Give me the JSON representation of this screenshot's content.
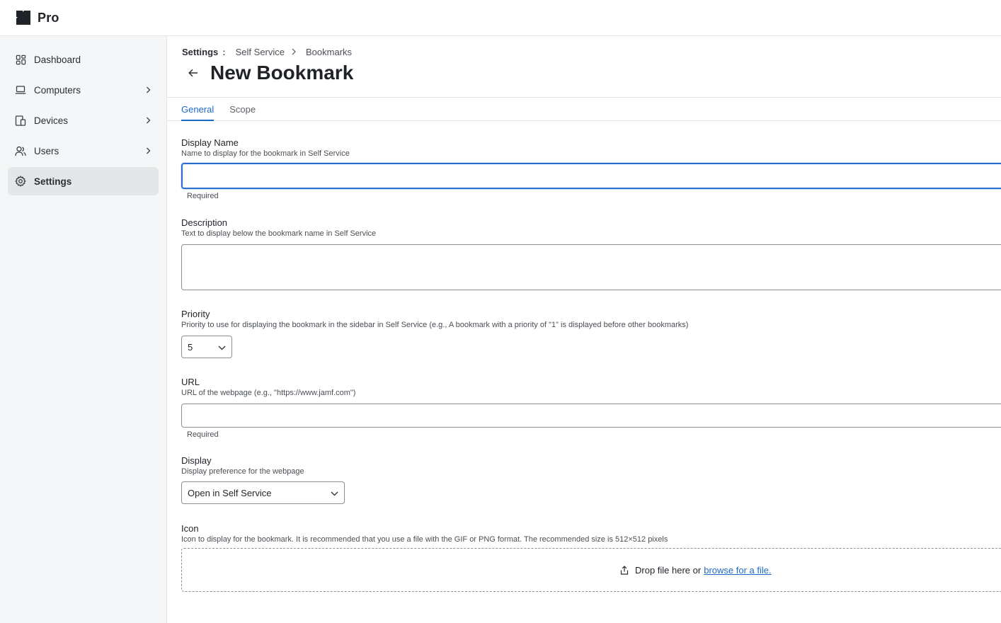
{
  "app": {
    "logo_text": "Pro"
  },
  "sidebar": {
    "items": [
      {
        "label": "Dashboard",
        "icon": "dashboard-icon",
        "active": false,
        "has_children": false
      },
      {
        "label": "Computers",
        "icon": "laptop-icon",
        "active": false,
        "has_children": true
      },
      {
        "label": "Devices",
        "icon": "devices-icon",
        "active": false,
        "has_children": true
      },
      {
        "label": "Users",
        "icon": "users-icon",
        "active": false,
        "has_children": true
      },
      {
        "label": "Settings",
        "icon": "gear-icon",
        "active": true,
        "has_children": false
      }
    ]
  },
  "breadcrumb": {
    "root": "Settings",
    "separator": ":",
    "level1": "Self Service",
    "level2": "Bookmarks"
  },
  "page": {
    "title": "New Bookmark"
  },
  "tabs": [
    {
      "label": "General",
      "active": true
    },
    {
      "label": "Scope",
      "active": false
    }
  ],
  "form": {
    "display_name": {
      "label": "Display Name",
      "help": "Name to display for the bookmark in Self Service",
      "value": "",
      "required_text": "Required"
    },
    "description": {
      "label": "Description",
      "help": "Text to display below the bookmark name in Self Service",
      "value": ""
    },
    "priority": {
      "label": "Priority",
      "help": "Priority to use for displaying the bookmark in the sidebar in Self Service (e.g., A bookmark with a priority of \"1\" is displayed before other bookmarks)",
      "value": "5"
    },
    "url": {
      "label": "URL",
      "help": "URL of the webpage (e.g., \"https://www.jamf.com\")",
      "value": "",
      "required_text": "Required"
    },
    "display": {
      "label": "Display",
      "help": "Display preference for the webpage",
      "value": "Open in Self Service"
    },
    "icon": {
      "label": "Icon",
      "help": "Icon to display for the bookmark. It is recommended that you use a file with the GIF or PNG format. The recommended size is 512×512 pixels",
      "drop_text": "Drop file here or",
      "browse_text": "browse for a file."
    }
  },
  "colors": {
    "accent": "#1f6bc4",
    "focus": "#2a6fd0",
    "sidebar_bg": "#f5f6f7",
    "active_bg": "#e4e6e8"
  }
}
